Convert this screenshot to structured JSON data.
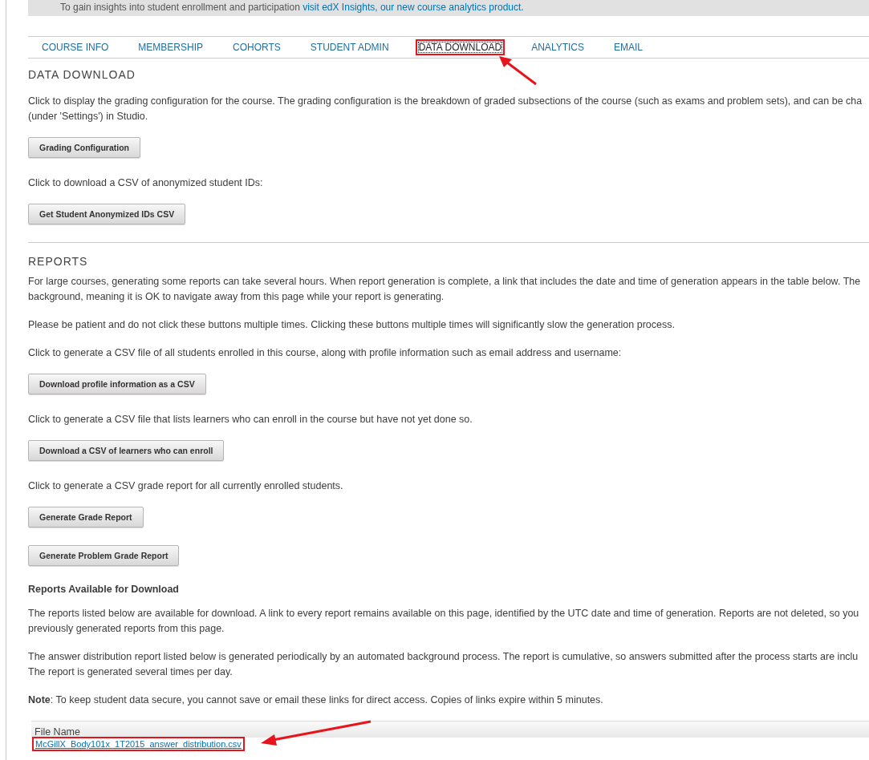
{
  "banner": {
    "text": "To gain insights into student enrollment and participation",
    "link": "visit edX Insights, our new course analytics product."
  },
  "tabs": [
    {
      "label": "COURSE INFO",
      "selected": false,
      "highlighted": false
    },
    {
      "label": "MEMBERSHIP",
      "selected": false,
      "highlighted": false
    },
    {
      "label": "COHORTS",
      "selected": false,
      "highlighted": false
    },
    {
      "label": "STUDENT ADMIN",
      "selected": false,
      "highlighted": false
    },
    {
      "label": "DATA DOWNLOAD",
      "selected": true,
      "highlighted": true
    },
    {
      "label": "ANALYTICS",
      "selected": false,
      "highlighted": false
    },
    {
      "label": "EMAIL",
      "selected": false,
      "highlighted": false
    }
  ],
  "sections": [
    {
      "title": "DATA DOWNLOAD",
      "blocks": [
        {
          "kind": "text",
          "lines": [
            "Click to display the grading configuration for the course. The grading configuration is the breakdown of graded subsections of the course (such as exams and problem sets), and can be cha",
            "(under 'Settings') in Studio."
          ]
        },
        {
          "kind": "button",
          "label": "Grading Configuration"
        },
        {
          "kind": "text",
          "lines": [
            "Click to download a CSV of anonymized student IDs:"
          ]
        },
        {
          "kind": "button",
          "label": "Get Student Anonymized IDs CSV"
        }
      ]
    },
    {
      "title": "REPORTS",
      "blocks": [
        {
          "kind": "text",
          "lines": [
            "For large courses, generating some reports can take several hours. When report generation is complete, a link that includes the date and time of generation appears in the table below. The",
            "background, meaning it is OK to navigate away from this page while your report is generating."
          ]
        },
        {
          "kind": "text",
          "lines": [
            "Please be patient and do not click these buttons multiple times. Clicking these buttons multiple times will significantly slow the generation process."
          ]
        },
        {
          "kind": "text",
          "lines": [
            "Click to generate a CSV file of all students enrolled in this course, along with profile information such as email address and username:"
          ]
        },
        {
          "kind": "button",
          "label": "Download profile information as a CSV"
        },
        {
          "kind": "text",
          "lines": [
            "Click to generate a CSV file that lists learners who can enroll in the course but have not yet done so."
          ]
        },
        {
          "kind": "button",
          "label": "Download a CSV of learners who can enroll"
        },
        {
          "kind": "text",
          "lines": [
            "Click to generate a CSV grade report for all currently enrolled students."
          ]
        },
        {
          "kind": "button",
          "label": "Generate Grade Report"
        },
        {
          "kind": "button",
          "label": "Generate Problem Grade Report"
        },
        {
          "kind": "subheading",
          "lines": [
            "Reports Available for Download"
          ]
        },
        {
          "kind": "text",
          "lines": [
            "The reports listed below are available for download. A link to every report remains available on this page, identified by the UTC date and time of generation. Reports are not deleted, so you",
            "previously generated reports from this page."
          ]
        },
        {
          "kind": "text",
          "lines": [
            "The answer distribution report listed below is generated periodically by an automated background process. The report is cumulative, so answers submitted after the process starts are inclu",
            "The report is generated several times per day."
          ]
        },
        {
          "kind": "text",
          "lines": [
            "**Note**: To keep student data secure, you cannot save or email these links for direct access. Copies of links expire within 5 minutes."
          ]
        }
      ]
    }
  ],
  "report_table": {
    "column": "File Name",
    "rows": [
      {
        "file": "McGillX_Body101x_1T2015_answer_distribution.csv",
        "highlighted": true
      }
    ]
  }
}
